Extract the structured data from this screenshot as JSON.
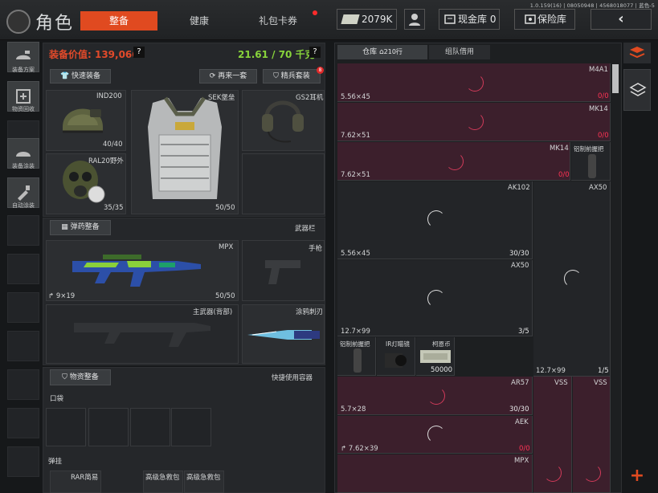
{
  "version": "1.0.159(16) | 08050948 | 4568018077 | 蓝色-5",
  "header": {
    "title": "角色",
    "tabs": [
      "整备",
      "健康",
      "礼包卡券"
    ],
    "cash": "2079K",
    "vault_label": "现金库 0",
    "safe_label": "保险库",
    "back_glyph": "‹"
  },
  "sidebar": [
    "装备方案",
    "物资回收",
    "装备涂装",
    "自动涂装"
  ],
  "equip": {
    "value_label": "装备价值: 139,066",
    "weight": "21.61 / 70 千克",
    "help": "?",
    "quick_btn": "快速装备",
    "again_btn": "再来一套",
    "elite_btn": "精兵套装",
    "elite_badge": "8",
    "helmet": {
      "name": "IND200",
      "count": "40/40"
    },
    "vest": {
      "name": "SEK堡垒",
      "count": "50/50"
    },
    "headset": {
      "name": "GS2耳机"
    },
    "mask": {
      "name": "RAL20野外",
      "count": "35/35"
    }
  },
  "ammo": {
    "btn": "弹药整备",
    "weapons_label": "武器栏",
    "primary": {
      "name": "MPX",
      "caliber": "9×19",
      "count": "50/50"
    },
    "pistol": "手枪",
    "back": "主武器(背部)",
    "knife": "涂鸦刺刃"
  },
  "supply": {
    "btn": "物资整备",
    "quick_label": "快捷使用容器",
    "pocket": "口袋",
    "rig": "弹挂",
    "rig_items": [
      "RAR简易",
      "高级急救包",
      "高级急救包"
    ]
  },
  "warehouse": {
    "tab": "仓库",
    "rows": "210行",
    "team": "组队借用",
    "items": [
      {
        "name": "M4A1",
        "caliber": "5.56×45",
        "count": "0/0"
      },
      {
        "name": "MK14",
        "caliber": "7.62×51",
        "count": "0/0"
      },
      {
        "name": "MK14",
        "caliber": "7.62×51",
        "count": "0/0"
      },
      {
        "name": "铝制前握把"
      },
      {
        "name": "AK102",
        "caliber": "5.56×45",
        "count": "30/30"
      },
      {
        "name": "AX50",
        "caliber": "12.7×99",
        "count": "1/5"
      },
      {
        "name": "AX50",
        "caliber": "12.7×99",
        "count": "3/5"
      },
      {
        "name": "铝制前握把"
      },
      {
        "name": "IR灯瞄镜"
      },
      {
        "name": "柯恩币",
        "count": "50000"
      },
      {
        "name": "AR57",
        "caliber": "5.7×28",
        "count": "30/30"
      },
      {
        "name": "VSS"
      },
      {
        "name": "VSS"
      },
      {
        "name": "AEK",
        "caliber": "7.62×39",
        "count": "0/0"
      },
      {
        "name": "MPX"
      }
    ],
    "add": "+"
  }
}
